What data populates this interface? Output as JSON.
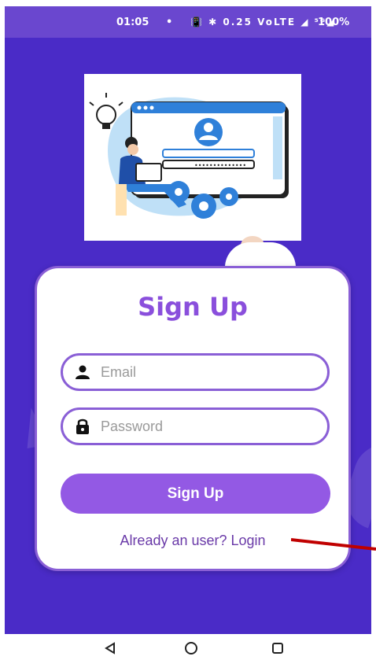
{
  "status_bar": {
    "time": "01:05",
    "dot": "•",
    "icons_text": "📳 ✱ 0.25 VoLTE ◢ ⁵ᴳ◢",
    "battery": "100%"
  },
  "signup": {
    "title": "Sign Up",
    "email_placeholder": "Email",
    "password_placeholder": "Password",
    "button_label": "Sign Up",
    "login_link": "Already an user? Login"
  },
  "icons": {
    "email": "person-icon",
    "password": "lock-icon",
    "back": "back-triangle-icon",
    "home": "home-circle-icon",
    "recent": "recent-square-icon"
  },
  "colors": {
    "background": "#4a2bc7",
    "status_bar": "#6a47cf",
    "accent": "#8a4fdc",
    "button": "#9359e4",
    "link": "#6a3aa8",
    "annotation_arrow": "#c00000"
  }
}
